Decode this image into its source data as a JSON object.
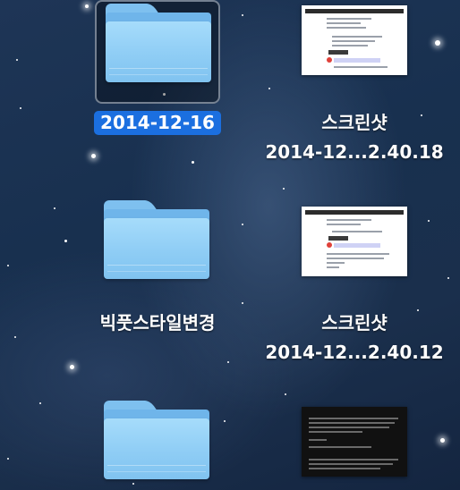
{
  "desktop": {
    "items": [
      {
        "name": "2014-12-16",
        "kind": "folder",
        "selected": true
      },
      {
        "name_line1": "스크린샷",
        "name_line2": "2014-12...2.40.18",
        "kind": "screenshot"
      },
      {
        "name": "빅풋스타일변경",
        "kind": "folder",
        "selected": false
      },
      {
        "name_line1": "스크린샷",
        "name_line2": "2014-12...2.40.12",
        "kind": "screenshot"
      },
      {
        "name": "",
        "kind": "folder",
        "selected": false
      },
      {
        "name": "",
        "kind": "screenshot"
      }
    ]
  },
  "colors": {
    "selection": "#1b6fe0",
    "folder": "#8fcdf5",
    "background": "#1a2f4c"
  }
}
